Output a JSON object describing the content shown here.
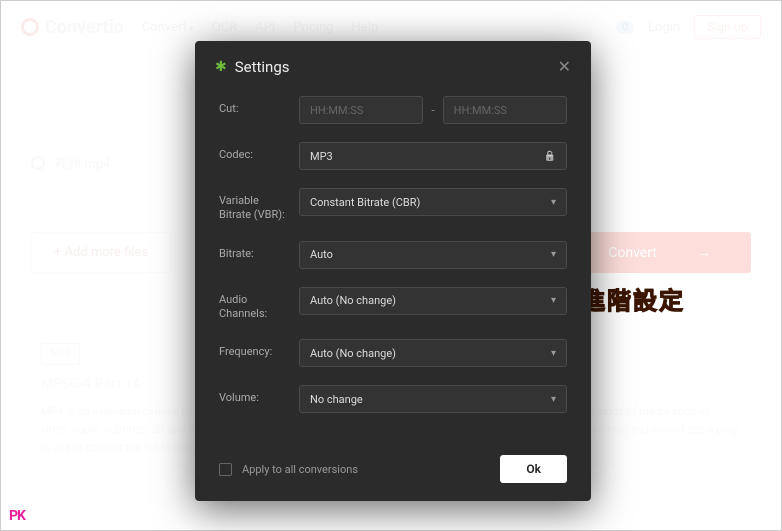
{
  "header": {
    "logo": "Convertio",
    "nav": [
      "Convert",
      "OCR",
      "API",
      "Pricing",
      "Help"
    ],
    "login": "Login",
    "signup": "Sign Up",
    "badge": "0"
  },
  "file": {
    "name": "视频.mp4"
  },
  "actions": {
    "add": "Add more files",
    "convert": "Convert"
  },
  "desc": {
    "badge": "MP4",
    "title": "MPEG-4 Part 14",
    "text": "MP4 is an extension defined by MPEG-4 video standard and AAC audio standard. It is a container that supports all kinds of media such as video, audio, subtitles, 2D and 3D graphics. It is possible to open MP4 file with almost any player on Windows but on Mac you should use a plug-in or just convert the file to another format."
  },
  "annotation": "進階設定",
  "watermark": "PK",
  "modal": {
    "title": "Settings",
    "labels": {
      "cut": "Cut:",
      "codec": "Codec:",
      "vbr": "Variable Bitrate (VBR):",
      "bitrate": "Bitrate:",
      "channels": "Audio Channels:",
      "frequency": "Frequency:",
      "volume": "Volume:"
    },
    "values": {
      "cut_from_ph": "HH:MM:SS",
      "cut_to_ph": "HH:MM:SS",
      "codec": "MP3",
      "vbr": "Constant Bitrate (CBR)",
      "bitrate": "Auto",
      "channels": "Auto (No change)",
      "frequency": "Auto (No change)",
      "volume": "No change"
    },
    "apply": "Apply to all conversions",
    "ok": "Ok"
  }
}
